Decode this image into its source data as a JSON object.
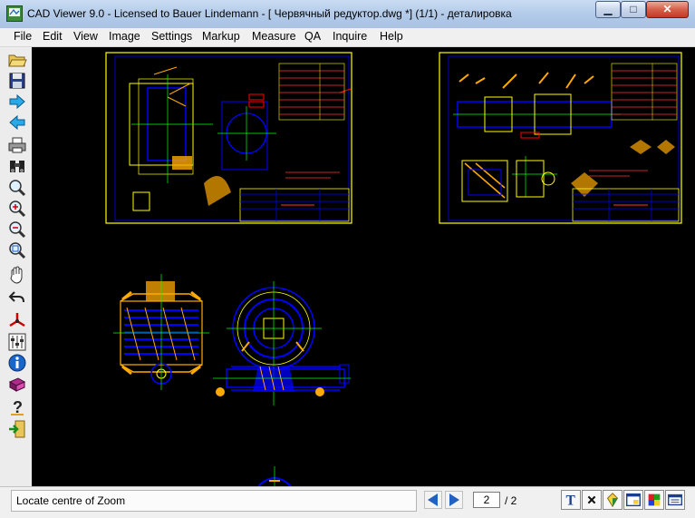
{
  "window": {
    "title": "CAD Viewer 9.0 - Licensed to Bauer Lindemann  -  [ Червячный редуктор.dwg *] (1/1)  -  деталировка",
    "minimize_glyph": "▁",
    "maximize_glyph": "□",
    "close_glyph": "✕"
  },
  "menu": {
    "items": [
      {
        "label": "File"
      },
      {
        "label": "Edit"
      },
      {
        "label": "View"
      },
      {
        "label": "Image"
      },
      {
        "label": "Settings"
      },
      {
        "label": "Markup"
      },
      {
        "label": "Measure"
      },
      {
        "label": "QA"
      },
      {
        "label": "Inquire"
      },
      {
        "label": "Help"
      }
    ]
  },
  "toolbar": {
    "icons": [
      "open-folder-icon",
      "save-icon",
      "forward-arrow-icon",
      "back-arrow-icon",
      "print-icon",
      "binoculars-icon",
      "zoom-icon",
      "zoom-in-icon",
      "zoom-out-icon",
      "zoom-window-icon",
      "pan-hand-icon",
      "undo-view-icon",
      "axes-icon",
      "layers-icon",
      "info-icon",
      "book-icon",
      "help-icon",
      "exit-icon"
    ]
  },
  "drawing": {
    "colors": {
      "background": "#000000",
      "frame": "#ffff00",
      "part_outline": "#0000ff",
      "centerline": "#00ff00",
      "annotation": "#ff0000",
      "hatch": "#ffaa00"
    }
  },
  "status": {
    "message": "Locate centre of Zoom",
    "page_current": "2",
    "page_total": "/ 2"
  },
  "statusbar_icons": [
    "text-toggle-icon",
    "close-markup-icon",
    "color-icon",
    "window-icon",
    "palette-icon",
    "fullscreen-icon"
  ]
}
